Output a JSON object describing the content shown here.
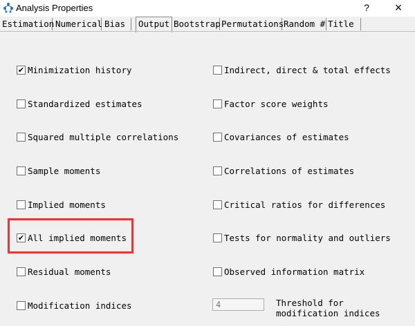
{
  "window": {
    "title": "Analysis Properties",
    "help_glyph": "?",
    "close_glyph": "×"
  },
  "tabs": [
    {
      "label": "Estimation"
    },
    {
      "label": "Numerical"
    },
    {
      "label": "Bias"
    },
    {
      "label": "Output",
      "active": true
    },
    {
      "label": "Bootstrap"
    },
    {
      "label": "Permutations"
    },
    {
      "label": "Random #"
    },
    {
      "label": "Title"
    }
  ],
  "options_left": [
    {
      "label": "Minimization history",
      "checked": true
    },
    {
      "label": "Standardized estimates",
      "checked": false
    },
    {
      "label": "Squared multiple correlations",
      "checked": false
    },
    {
      "label": "Sample moments",
      "checked": false
    },
    {
      "label": "Implied moments",
      "checked": false
    },
    {
      "label": "All implied moments",
      "checked": true
    },
    {
      "label": "Residual moments",
      "checked": false
    },
    {
      "label": "Modification indices",
      "checked": false
    }
  ],
  "options_right": [
    {
      "label": "Indirect, direct & total effects",
      "checked": false
    },
    {
      "label": "Factor score weights",
      "checked": false
    },
    {
      "label": "Covariances of estimates",
      "checked": false
    },
    {
      "label": "Correlations of estimates",
      "checked": false
    },
    {
      "label": "Critical ratios for differences",
      "checked": false
    },
    {
      "label": "Tests for normality and outliers",
      "checked": false
    },
    {
      "label": "Observed information matrix",
      "checked": false
    }
  ],
  "threshold": {
    "value": "4",
    "label": "Threshold for\nmodification indices"
  },
  "check_glyph": "✔",
  "colors": {
    "highlight": "#e23a3a",
    "background": "#f0f0f0"
  }
}
